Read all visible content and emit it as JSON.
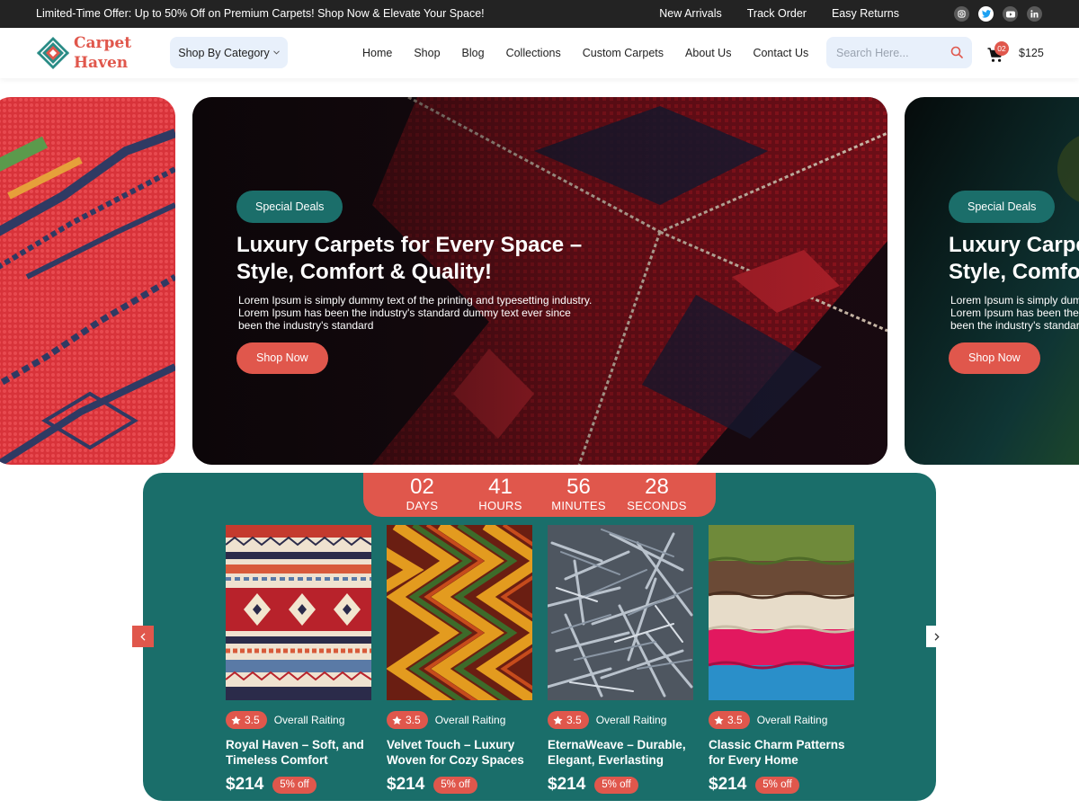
{
  "topbar": {
    "promo": "Limited-Time Offer: Up to 50% Off on Premium Carpets! Shop Now & Elevate Your Space!",
    "links": [
      "New Arrivals",
      "Track Order",
      "Easy Returns"
    ],
    "social": [
      "instagram-icon",
      "twitter-icon",
      "youtube-icon",
      "linkedin-icon"
    ]
  },
  "header": {
    "logo_line1": "Carpet",
    "logo_line2": "Haven",
    "category_button": "Shop By Category",
    "nav": [
      "Home",
      "Shop",
      "Blog",
      "Collections",
      "Custom Carpets",
      "About Us",
      "Contact Us"
    ],
    "search_placeholder": "Search Here...",
    "cart_count": "02",
    "cart_total": "$125"
  },
  "hero": {
    "badge": "Special Deals",
    "title": "Luxury Carpets for Every Space – Style, Comfort & Quality!",
    "text": "Lorem Ipsum is simply dummy text of the printing and typesetting industry. Lorem Ipsum has been the industry's standard dummy text ever since  been the industry's standard",
    "button": "Shop Now"
  },
  "timer": {
    "days": "02",
    "days_label": "DAYS",
    "hours": "41",
    "hours_label": "HOURS",
    "minutes": "56",
    "minutes_label": "MINUTES",
    "seconds": "28",
    "seconds_label": "SECONDS"
  },
  "products": [
    {
      "rating": "3.5",
      "rating_label": "Overall Raiting",
      "name": "Royal Haven – Soft, and Timeless Comfort",
      "price": "$214",
      "discount": "5% off"
    },
    {
      "rating": "3.5",
      "rating_label": "Overall Raiting",
      "name": "Velvet Touch – Luxury Woven for Cozy Spaces",
      "price": "$214",
      "discount": "5% off"
    },
    {
      "rating": "3.5",
      "rating_label": "Overall Raiting",
      "name": "EternaWeave – Durable, Elegant, Everlasting",
      "price": "$214",
      "discount": "5% off"
    },
    {
      "rating": "3.5",
      "rating_label": "Overall Raiting",
      "name": "Classic Charm Patterns for Every Home",
      "price": "$214",
      "discount": "5% off"
    }
  ],
  "colors": {
    "accent": "#e0574c",
    "teal": "#1a6e6a",
    "topbar": "#232323",
    "search_bg": "#e8f0fb"
  }
}
